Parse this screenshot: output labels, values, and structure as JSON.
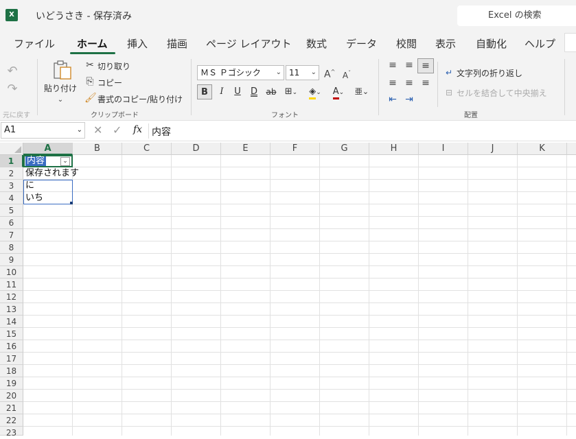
{
  "titlebar": {
    "app_icon": "excel-icon",
    "app_icon_letter": "X",
    "title": "いどうさき - 保存済み",
    "search_label": "Excel の検索"
  },
  "tabs": [
    {
      "label": "ファイル"
    },
    {
      "label": "ホーム",
      "active": true
    },
    {
      "label": "挿入"
    },
    {
      "label": "描画"
    },
    {
      "label": "ページ レイアウト"
    },
    {
      "label": "数式"
    },
    {
      "label": "データ"
    },
    {
      "label": "校閲"
    },
    {
      "label": "表示"
    },
    {
      "label": "自動化"
    },
    {
      "label": "ヘルプ"
    }
  ],
  "ribbon": {
    "undo": {
      "label": "元に戻す"
    },
    "clipboard": {
      "paste": "貼り付け",
      "cut": "切り取り",
      "copy": "コピー",
      "format_painter": "書式のコピー/貼り付け",
      "group_label": "クリップボード"
    },
    "font": {
      "font_name": "ＭＳ Ｐゴシック",
      "font_size": "11",
      "group_label": "フォント",
      "bold": "B",
      "italic": "I",
      "underline": "U",
      "double_underline": "D",
      "strike": "ab",
      "font_color_glyph": "A"
    },
    "alignment": {
      "wrap_text": "文字列の折り返し",
      "merge_center": "セルを結合して中央揃え",
      "group_label": "配置"
    },
    "accent_color": "#1e7145",
    "font_color": "#c00000",
    "fill_color": "#ffd600"
  },
  "formula_bar": {
    "name_box": "A1",
    "fx": "fx",
    "content": "内容"
  },
  "sheet": {
    "columns": [
      "A",
      "B",
      "C",
      "D",
      "E",
      "F",
      "G",
      "H",
      "I",
      "J",
      "K"
    ],
    "rows": [
      "1",
      "2",
      "3",
      "4",
      "5",
      "6",
      "7",
      "8",
      "9",
      "10",
      "11",
      "12",
      "13",
      "14",
      "15",
      "16",
      "17",
      "18",
      "19",
      "20",
      "21",
      "22",
      "23"
    ],
    "cells": {
      "A1": "内容",
      "A2": "保存されます",
      "A3": "に",
      "A4": "いち"
    },
    "selected_cell": "A1",
    "filter_glyph": "⌄"
  }
}
